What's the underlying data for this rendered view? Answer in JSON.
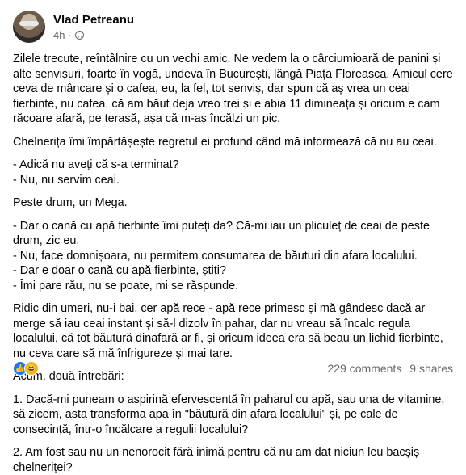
{
  "post": {
    "author": "Vlad Petreanu",
    "time": "4h",
    "separator": "·",
    "paragraphs": [
      "Zilele trecute, reîntâlnire cu un vechi amic. Ne vedem la o cârciumioară de panini și alte senvișuri, foarte în vogă, undeva în București, lângă Piața Floreasca. Amicul cere ceva de mâncare și o cafea, eu, la fel, tot senviș, dar spun că aș vrea un ceai fierbinte, nu cafea, că am băut deja vreo trei și e abia 11 dimineața și oricum e cam răcoare afară, pe terasă, așa că m-aș încălzi un pic.",
      "Chelnerița îmi împărtășește regretul ei profund când mă informează că nu au ceai.",
      "- Adică nu aveți că s-a terminat?\n- Nu, nu servim ceai.",
      "Peste drum, un Mega.",
      "- Dar o cană cu apă fierbinte îmi puteți da? Că-mi iau un pliculeț de ceai de peste drum, zic eu.\n- Nu, face domnișoara, nu permitem consumarea de băuturi din afara localului.\n- Dar e doar o cană cu apă fierbinte, știți?\n- Îmi pare rău, nu se poate, mi se răspunde.",
      "Ridic din umeri, nu-i bai, cer apă rece - apă rece primesc și mă gândesc dacă ar merge să iau ceai instant și să-l dizolv în pahar, dar nu vreau să încalc regula localului, că tot băutură dinafară ar fi, și oricum ideea era să beau un lichid fierbinte, nu ceva care să mă înfrigureze și mai tare.",
      "Acum, două întrebări:",
      "1. Dacă-mi puneam o aspirină efervescentă în paharul cu apă, sau una de vitamine, să zicem, asta transforma apa în \"băutură din afara localului\" și, pe cale de consecință, într-o încălcare a regulii localului?",
      "2. Am fost sau nu un nenorocit fără inimă pentru că nu am dat niciun leu bacșiș chelneriței?"
    ]
  },
  "footer": {
    "comments": "229 comments",
    "shares": "9 shares",
    "reactions": [
      "like-icon",
      "haha-icon"
    ]
  },
  "colors": {
    "text": "#050505",
    "secondary": "#65676b",
    "like": "#1877f2",
    "haha": "#f7b125"
  }
}
